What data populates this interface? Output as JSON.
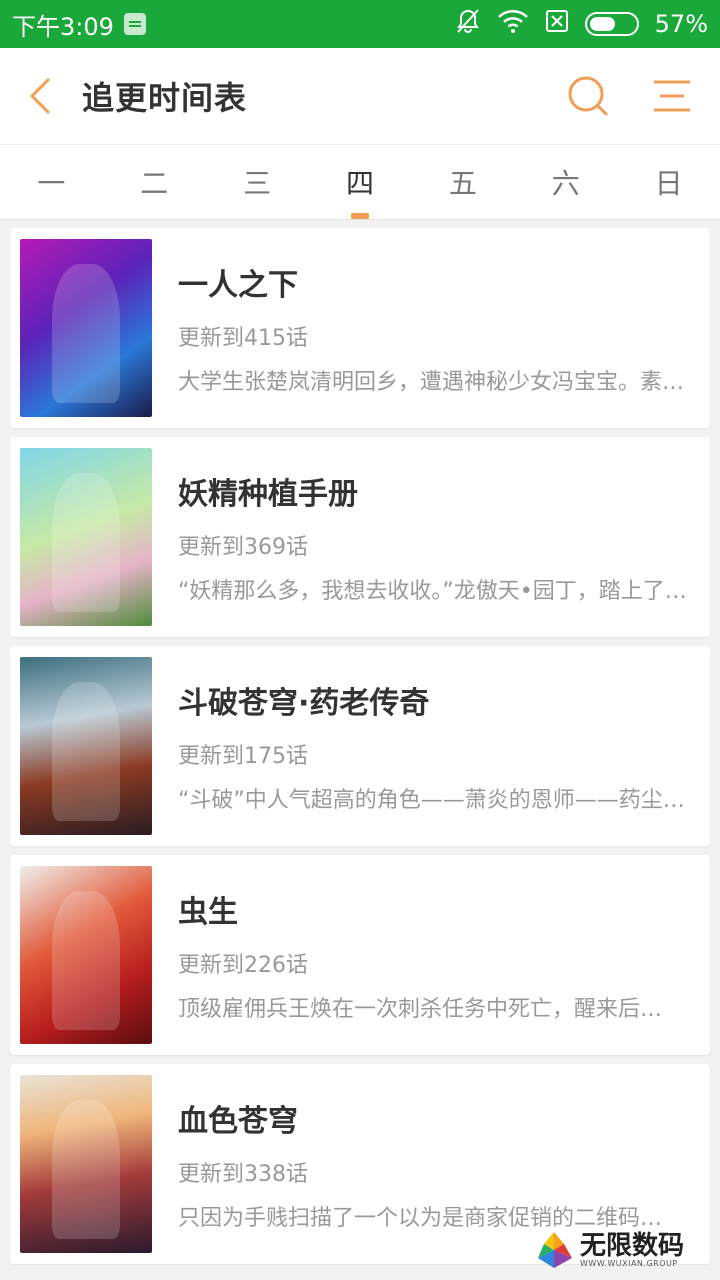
{
  "status_bar": {
    "time": "下午3:09",
    "battery": "57%",
    "battery_level": 0.57,
    "icons": [
      "sim-card-icon",
      "mute-bell-icon",
      "wifi-icon",
      "no-sim-icon",
      "battery-icon"
    ]
  },
  "header": {
    "title": "追更时间表",
    "icons": [
      "back-arrow-icon",
      "search-icon",
      "menu-icon"
    ],
    "accent": "#f39c56"
  },
  "tabs": [
    {
      "label": "一"
    },
    {
      "label": "二"
    },
    {
      "label": "三"
    },
    {
      "label": "四",
      "active": true
    },
    {
      "label": "五"
    },
    {
      "label": "六"
    },
    {
      "label": "日"
    }
  ],
  "comics": [
    {
      "title": "一人之下",
      "update": "更新到415话",
      "desc": "大学生张楚岚清明回乡，遭遇神秘少女冯宝宝。素…"
    },
    {
      "title": "妖精种植手册",
      "update": "更新到369话",
      "desc": "“妖精那么多，我想去收收。”龙傲天•园丁，踏上了…"
    },
    {
      "title": "斗破苍穹·药老传奇",
      "update": "更新到175话",
      "desc": "“斗破”中人气超高的角色——萧炎的恩师——药尘…"
    },
    {
      "title": "虫生",
      "update": "更新到226话",
      "desc": "顶级雇佣兵王焕在一次刺杀任务中死亡，醒来后…"
    },
    {
      "title": "血色苍穹",
      "update": "更新到338话",
      "desc": "只因为手贱扫描了一个以为是商家促销的二维码…"
    }
  ],
  "watermark": {
    "text": "无限数码",
    "sub": "WWW.WUXIAN.GROUP"
  },
  "colors": {
    "status_bar": "#1aa83a",
    "tab_indicator": "#f39c56"
  }
}
